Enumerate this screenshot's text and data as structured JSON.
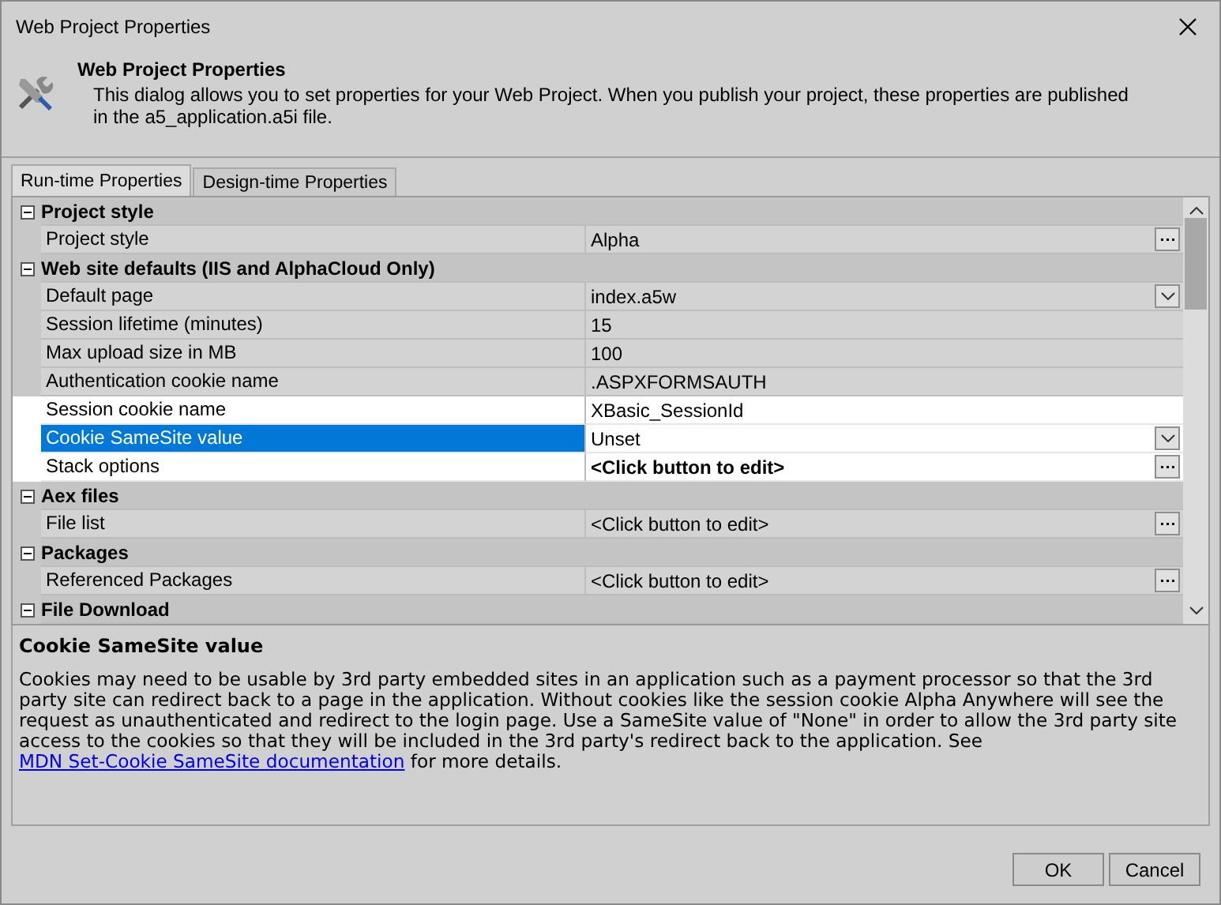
{
  "window": {
    "title": "Web Project Properties"
  },
  "header": {
    "title": "Web Project Properties",
    "text": "This dialog allows you to set properties for your Web Project. When you publish your project, these properties are published in the a5_application.a5i file."
  },
  "tabs": [
    {
      "label": "Run-time Properties",
      "selected": true
    },
    {
      "label": "Design-time Properties",
      "selected": false
    }
  ],
  "sections": [
    {
      "title": "Project style",
      "expanded": true,
      "rows": [
        {
          "name": "Project style",
          "value": "Alpha",
          "kind": "ellipsis",
          "selected": false,
          "highlighted": false,
          "bold": false
        }
      ]
    },
    {
      "title": "Web site defaults (IIS and AlphaCloud Only)",
      "expanded": true,
      "rows": [
        {
          "name": "Default page",
          "value": "index.a5w",
          "kind": "dropdown",
          "selected": false,
          "highlighted": false,
          "bold": false
        },
        {
          "name": "Session lifetime (minutes)",
          "value": "15",
          "kind": "text",
          "selected": false,
          "highlighted": false,
          "bold": false
        },
        {
          "name": "Max upload size in MB",
          "value": "100",
          "kind": "text",
          "selected": false,
          "highlighted": false,
          "bold": false
        },
        {
          "name": "Authentication cookie name",
          "value": ".ASPXFORMSAUTH",
          "kind": "text",
          "selected": false,
          "highlighted": false,
          "bold": false
        },
        {
          "name": "Session cookie name",
          "value": "XBasic_SessionId",
          "kind": "text",
          "selected": false,
          "highlighted": true,
          "bold": false
        },
        {
          "name": "Cookie SameSite value",
          "value": "Unset",
          "kind": "dropdown",
          "selected": true,
          "highlighted": true,
          "bold": false
        },
        {
          "name": "Stack options",
          "value": "<Click button to edit>",
          "kind": "ellipsis",
          "selected": false,
          "highlighted": true,
          "bold": true
        }
      ]
    },
    {
      "title": "Aex files",
      "expanded": true,
      "rows": [
        {
          "name": "File list",
          "value": "<Click button to edit>",
          "kind": "ellipsis",
          "selected": false,
          "highlighted": false,
          "bold": false
        }
      ]
    },
    {
      "title": "Packages",
      "expanded": true,
      "rows": [
        {
          "name": "Referenced Packages",
          "value": "<Click button to edit>",
          "kind": "ellipsis",
          "selected": false,
          "highlighted": false,
          "bold": false
        }
      ]
    },
    {
      "title": "File Download",
      "expanded": true
    }
  ],
  "description": {
    "title": "Cookie SameSite value",
    "text_before": "Cookies may need to be usable by 3rd party embedded sites in an application such as a payment processor so that the 3rd party site can redirect back to a page in the application. Without cookies like the session cookie Alpha Anywhere will see the request as unauthenticated and redirect to the login page. Use a SameSite value of \"None\" in order to allow the 3rd party site access to the cookies so that they will be included in the 3rd party's redirect back to the application. See",
    "link": "MDN Set-Cookie SameSite documentation",
    "text_after": "for more details."
  },
  "buttons": [
    {
      "label": "OK"
    },
    {
      "label": "Cancel"
    }
  ]
}
